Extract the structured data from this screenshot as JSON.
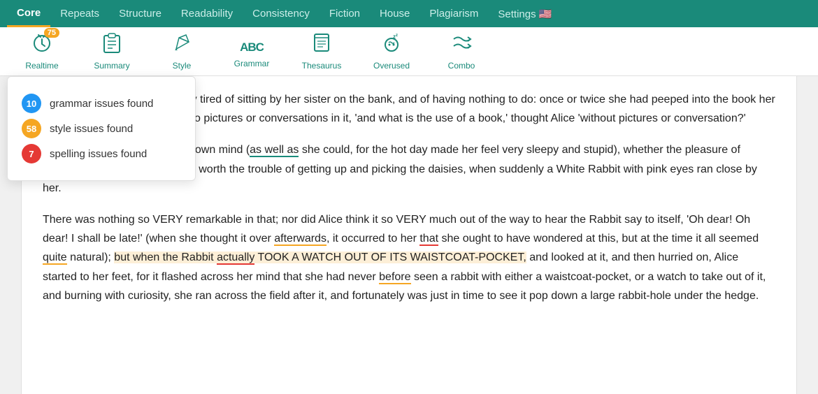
{
  "nav": {
    "items": [
      {
        "label": "Core",
        "active": true
      },
      {
        "label": "Repeats",
        "active": false
      },
      {
        "label": "Structure",
        "active": false
      },
      {
        "label": "Readability",
        "active": false
      },
      {
        "label": "Consistency",
        "active": false
      },
      {
        "label": "Fiction",
        "active": false
      },
      {
        "label": "House",
        "active": false
      },
      {
        "label": "Plagiarism",
        "active": false
      },
      {
        "label": "Settings 🇺🇸",
        "active": false
      }
    ]
  },
  "toolbar": {
    "items": [
      {
        "id": "realtime",
        "label": "Realtime",
        "icon": "clock-icon",
        "badge": "75"
      },
      {
        "id": "summary",
        "label": "Summary",
        "icon": "clipboard-icon",
        "badge": null
      },
      {
        "id": "style",
        "label": "Style",
        "icon": "pen-icon",
        "badge": null
      },
      {
        "id": "grammar",
        "label": "Grammar",
        "icon": "abc-icon",
        "badge": null
      },
      {
        "id": "thesaurus",
        "label": "Thesaurus",
        "icon": "book-icon",
        "badge": null
      },
      {
        "id": "overused",
        "label": "Overused",
        "icon": "sleep-icon",
        "badge": null
      },
      {
        "id": "combo",
        "label": "Combo",
        "icon": "shuffle-icon",
        "badge": null
      }
    ]
  },
  "dropdown": {
    "rows": [
      {
        "count": "10",
        "color": "blue",
        "label": "grammar issues found"
      },
      {
        "count": "58",
        "color": "yellow",
        "label": "style issues found"
      },
      {
        "count": "7",
        "color": "red",
        "label": "spelling issues found"
      }
    ]
  },
  "content": {
    "paragraphs": [
      "Alice was beginning to get very tired of sitting by her sister on the bank, and of having nothing to do: once or twice she had peeped into the book her sister was reading, but it had no pictures or conversations in it, 'and what is the use of a book,' thought Alice 'without pictures or conversation?'",
      "So she was considering in her own mind (as well as she could, for the hot day made her feel very sleepy and stupid), whether the pleasure of making a daisy-chain would be worth the trouble of getting up and picking the daisies, when suddenly a White Rabbit with pink eyes ran close by her.",
      "There was nothing so VERY remarkable in that; nor did Alice think it so VERY much out of the way to hear the Rabbit say to itself, 'Oh dear! Oh dear! I shall be late!' (when she thought it over afterwards, it occurred to her that she ought to have wondered at this, but at the time it all seemed quite natural); but when the Rabbit actually TOOK A WATCH OUT OF ITS WAISTCOAT-POCKET, and looked at it, and then hurried on, Alice started to her feet, for it flashed across her mind that she had never before seen a rabbit with either a waistcoat-pocket, or a watch to take out of it, and burning with curiosity, she ran across the field after it, and fortunately was just in time to see it pop down a large rabbit-hole under the hedge."
    ]
  }
}
